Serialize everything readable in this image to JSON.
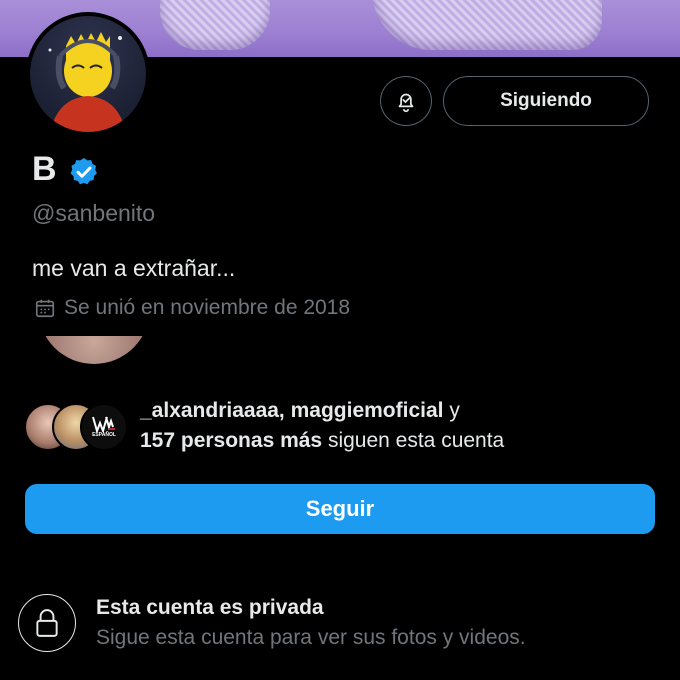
{
  "profile": {
    "name": "B",
    "handle": "@sanbenito",
    "bio": "me van a extrañar...",
    "joined": "Se unió en noviembre de 2018",
    "verified": true
  },
  "actions": {
    "following_label": "Siguiendo",
    "follow_label": "Seguir",
    "bell_icon": "notification-bell-icon"
  },
  "followers": {
    "names": "_alxandriaaaa, maggiemoficial",
    "connector": " y",
    "count_text": "157 personas más",
    "suffix": " siguen esta cuenta",
    "avatar3_label": "ESPAÑOL"
  },
  "privacy": {
    "title": "Esta cuenta es privada",
    "subtitle": "Sigue esta cuenta para ver sus fotos y videos."
  },
  "colors": {
    "accent": "#1d9bf0",
    "background": "#000000",
    "muted": "#71767b",
    "banner": "#9c7fd2"
  }
}
